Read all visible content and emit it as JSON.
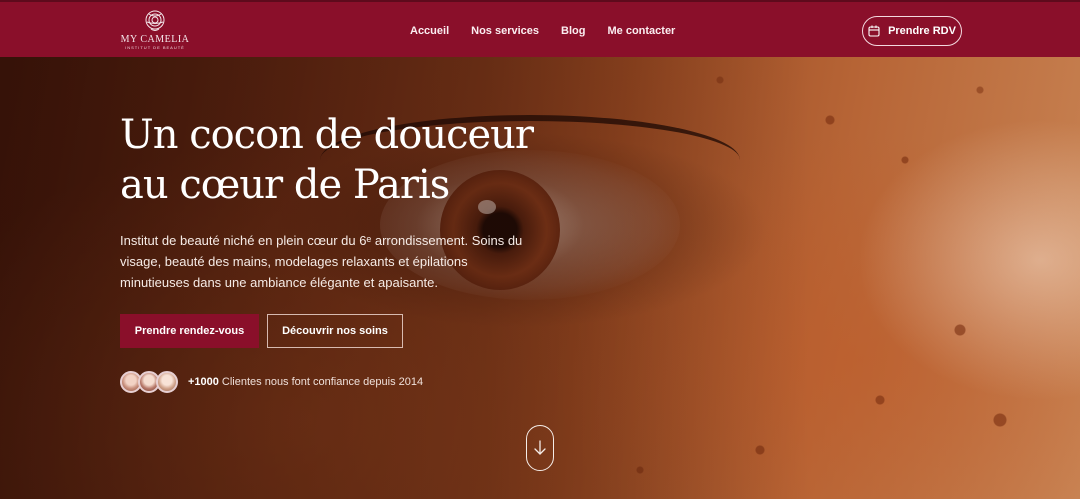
{
  "brand": {
    "name": "MY CAMELIA",
    "tagline": "INSTITUT DE BEAUTÉ",
    "color": "#8a0f2a"
  },
  "nav": {
    "links": [
      "Accueil",
      "Nos services",
      "Blog",
      "Me contacter"
    ],
    "cta_label": "Prendre RDV",
    "cta_icon": "calendar-icon"
  },
  "hero": {
    "title_line1": "Un cocon de douceur",
    "title_line2": "au cœur de Paris",
    "description": "Institut de beauté niché en plein cœur du 6ᵉ arrondissement. Soins du visage, beauté des mains, modelages relaxants et épilations minutieuses dans une ambiance élégante et apaisante.",
    "primary_button": "Prendre rendez-vous",
    "secondary_button": "Découvrir nos soins",
    "social_proof": {
      "count": "+1000",
      "text": "Clientes nous font confiance depuis 2014"
    },
    "scroll_icon": "arrow-down-icon"
  }
}
